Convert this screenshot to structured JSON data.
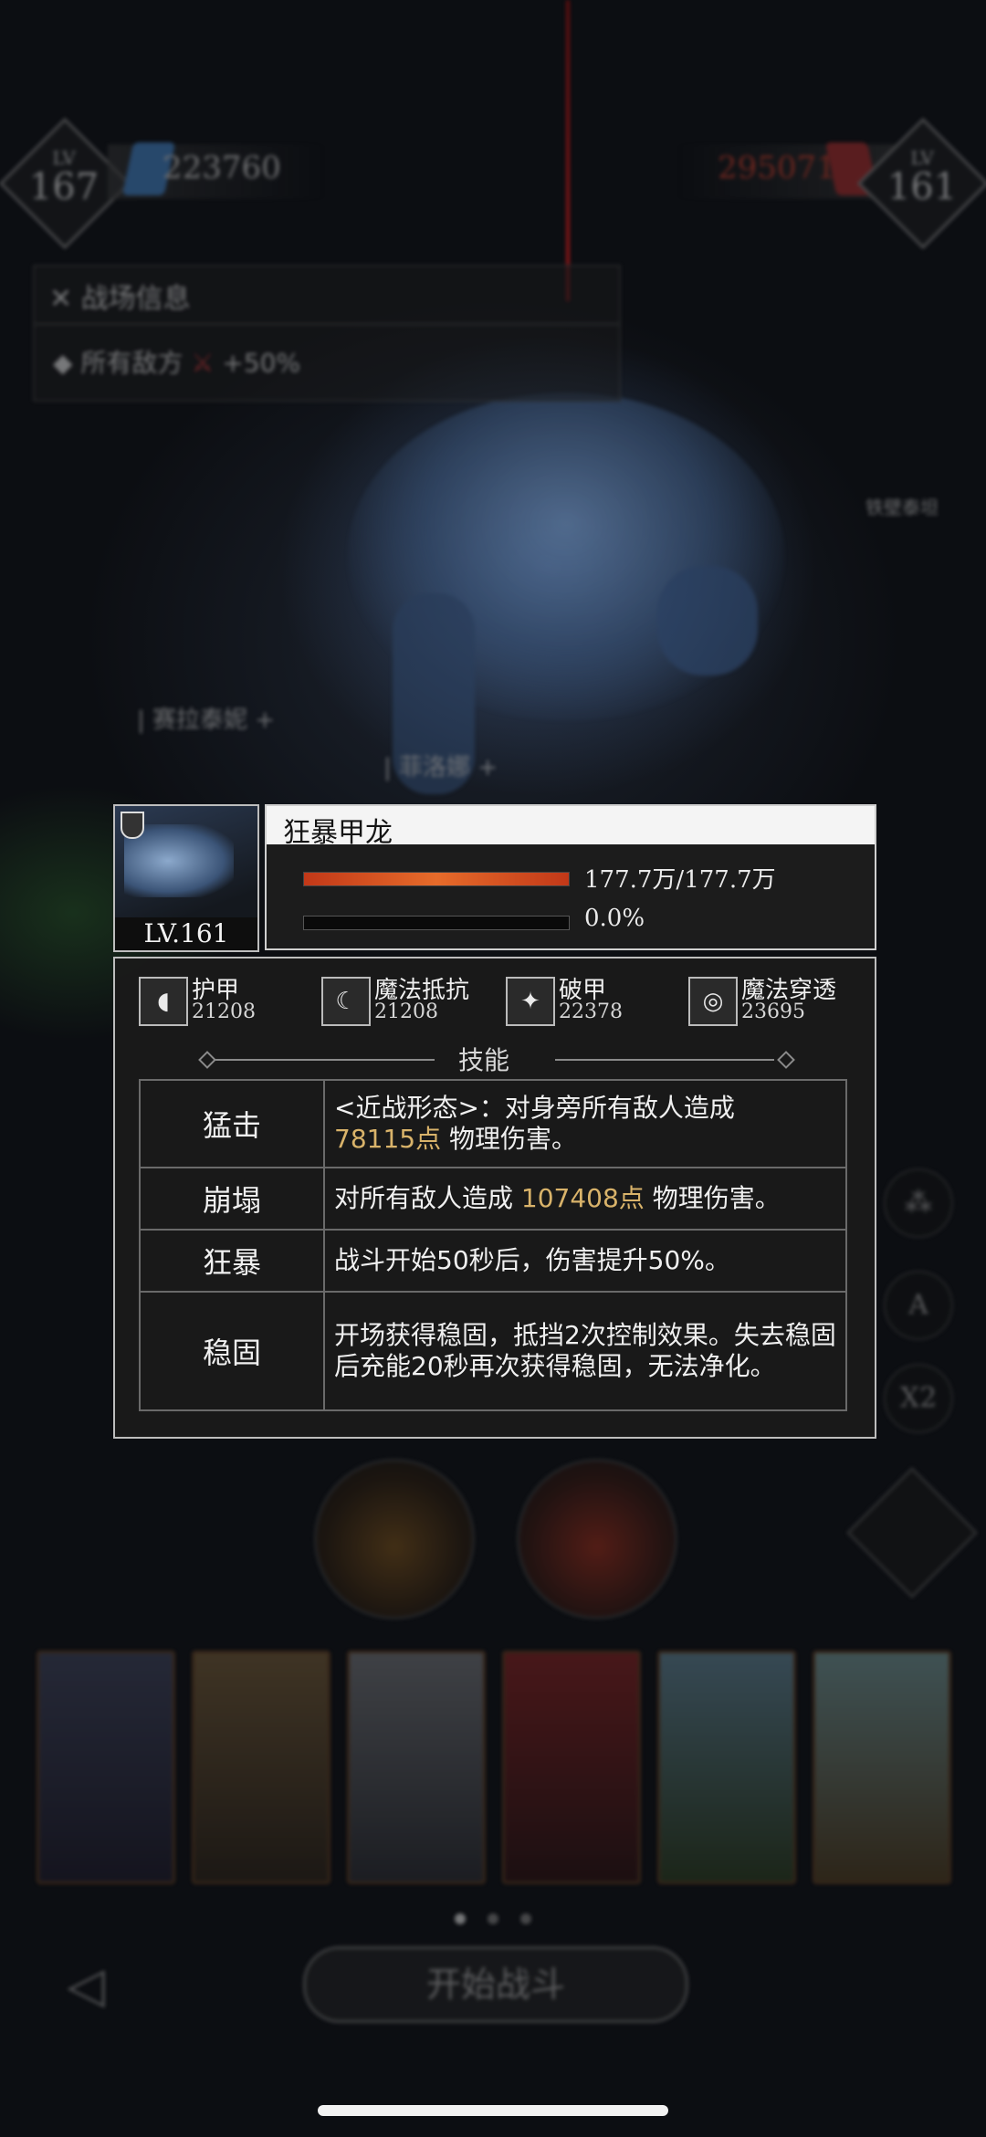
{
  "hud": {
    "player_level_label": "LV",
    "player_level": "167",
    "player_power": "223760",
    "enemy_power": "295071",
    "enemy_level_label": "LV",
    "enemy_level": "161",
    "battle_info_title": "战场信息",
    "battle_buff_prefix": "所有敌方",
    "battle_buff_mark": "⚔",
    "battle_buff_value": "+50%",
    "side_labels": [
      "铁壁泰坦",
      "赛拉泰妮",
      "菲洛娜"
    ],
    "speed_buttons": [
      "A",
      "X2"
    ]
  },
  "boss": {
    "name": "狂暴甲龙",
    "level": "LV.161",
    "hp_text": "177.7万/177.7万",
    "hp_fraction": 1.0,
    "shield_text": "0.0%",
    "shield_fraction": 0.0
  },
  "stats": [
    {
      "label": "护甲",
      "value": "21208",
      "icon": "armor-icon"
    },
    {
      "label": "魔法抵抗",
      "value": "21208",
      "icon": "magic-resist-icon"
    },
    {
      "label": "破甲",
      "value": "22378",
      "icon": "armor-break-icon"
    },
    {
      "label": "魔法穿透",
      "value": "23695",
      "icon": "magic-penetration-icon"
    }
  ],
  "skills_heading": "技能",
  "skills": [
    {
      "name": "猛击",
      "desc_pre": "<近战形态>：对身旁所有敌人造成",
      "highlight": "78115点",
      "desc_post": " 物理伤害。"
    },
    {
      "name": "崩塌",
      "desc_pre": "对所有敌人造成 ",
      "highlight": "107408点",
      "desc_post": " 物理伤害。"
    },
    {
      "name": "狂暴",
      "desc_pre": "战斗开始50秒后，伤害提升50%。",
      "highlight": "",
      "desc_post": ""
    },
    {
      "name": "稳固",
      "desc_pre": "开场获得稳固，抵挡2次控制效果。失去稳固后充能20秒再次获得稳固，无法净化。",
      "highlight": "",
      "desc_post": ""
    }
  ],
  "footer": {
    "start_label": "开始战斗",
    "colors": {
      "accent_gold": "#d9b36a",
      "hp_red": "#c23818"
    }
  }
}
